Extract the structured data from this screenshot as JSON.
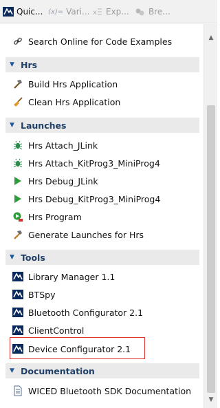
{
  "tabs": [
    {
      "label": "Quic...",
      "icon": "modus-icon",
      "active": true
    },
    {
      "label": "Vari...",
      "icon": "variables-icon",
      "prefix": "(x)="
    },
    {
      "label": "Exp...",
      "icon": "expressions-icon"
    },
    {
      "label": "Bre...",
      "icon": "breakpoints-icon"
    }
  ],
  "search": {
    "label": "Search Online for Code Examples",
    "icon": "link-icon"
  },
  "sections": [
    {
      "title": "Hrs",
      "items": [
        {
          "label": "Build Hrs Application",
          "icon": "hammer-icon"
        },
        {
          "label": "Clean Hrs Application",
          "icon": "broom-icon"
        }
      ]
    },
    {
      "title": "Launches",
      "items": [
        {
          "label": "Hrs Attach_JLink",
          "icon": "bug-attach-icon"
        },
        {
          "label": "Hrs Attach_KitProg3_MiniProg4",
          "icon": "bug-attach-icon"
        },
        {
          "label": "Hrs Debug_JLink",
          "icon": "debug-play-icon"
        },
        {
          "label": "Hrs Debug_KitProg3_MiniProg4",
          "icon": "debug-play-icon"
        },
        {
          "label": "Hrs Program",
          "icon": "program-icon"
        },
        {
          "label": "Generate Launches for Hrs",
          "icon": "hammer-icon"
        }
      ]
    },
    {
      "title": "Tools",
      "items": [
        {
          "label": "Library Manager 1.1",
          "icon": "modus-tool-icon"
        },
        {
          "label": "BTSpy",
          "icon": "modus-tool-icon"
        },
        {
          "label": "Bluetooth Configurator 2.1",
          "icon": "modus-tool-icon"
        },
        {
          "label": "ClientControl",
          "icon": "modus-tool-icon"
        },
        {
          "label": "Device Configurator 2.1",
          "icon": "modus-tool-icon"
        }
      ]
    },
    {
      "title": "Documentation",
      "items": [
        {
          "label": "WICED Bluetooth SDK Documentation",
          "icon": "document-icon"
        }
      ]
    }
  ],
  "colors": {
    "section_title": "#1f3f66",
    "section_bg": "#eaeaea",
    "highlight_border": "#e53333",
    "active_tab_underline": "#3c7fc6"
  }
}
